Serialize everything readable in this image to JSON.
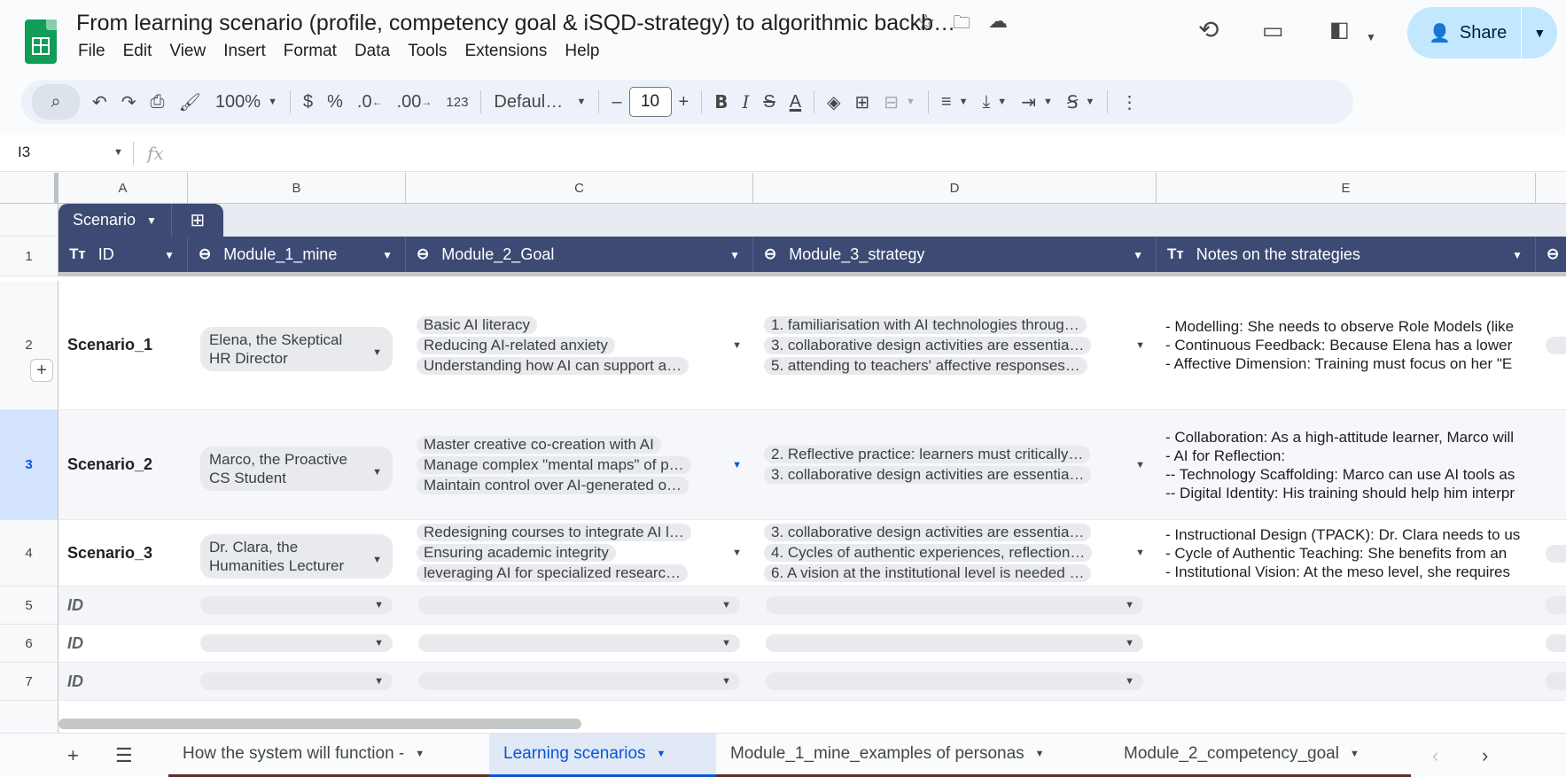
{
  "doc": {
    "title": "From learning scenario (profile, competency goal & iSQD-strategy) to algorithmic backb…",
    "menu": [
      "File",
      "Edit",
      "View",
      "Insert",
      "Format",
      "Data",
      "Tools",
      "Extensions",
      "Help"
    ],
    "share_label": "Share"
  },
  "toolbar": {
    "zoom": "100%",
    "currency": "$",
    "percent": "%",
    "dec_decrease": ".0",
    "dec_increase": ".00",
    "number_format": "123",
    "font": "Defaul…",
    "font_size": "10",
    "minus": "–",
    "plus": "+"
  },
  "formula_bar": {
    "cell_ref": "I3",
    "fx": "fx"
  },
  "columns": [
    "A",
    "B",
    "C",
    "D",
    "E"
  ],
  "table": {
    "name": "Scenario",
    "headers": [
      "ID",
      "Module_1_mine",
      "Module_2_Goal",
      "Module_3_strategy",
      "Notes on the strategies"
    ]
  },
  "rows": [
    {
      "num": "2",
      "id": "Scenario_1",
      "persona": "Elena, the Skeptical HR Director",
      "goals": [
        "Basic AI literacy",
        "Reducing AI-related anxiety",
        "Understanding how AI can support a…"
      ],
      "strategies": [
        "1. familiarisation with AI technologies throug…",
        "3. collaborative design activities are essentia…",
        "5. attending to teachers' affective responses…"
      ],
      "notes": [
        "- Modelling: She needs to observe Role Models (like",
        "- Continuous Feedback: Because Elena has a lower",
        "- Affective Dimension: Training must focus on her \"E"
      ]
    },
    {
      "num": "3",
      "id": "Scenario_2",
      "persona": "Marco, the Proactive CS Student",
      "goals": [
        "Master creative co-creation with AI",
        "Manage complex \"mental maps\" of p…",
        "Maintain control over AI-generated o…"
      ],
      "strategies": [
        "2. Reflective practice: learners must critically…",
        "3. collaborative design activities are essentia…"
      ],
      "notes": [
        "- Collaboration: As a high-attitude learner, Marco will",
        "- AI for Reflection:",
        "-- Technology Scaffolding: Marco can use AI tools as",
        "-- Digital Identity: His training should help him interpr"
      ]
    },
    {
      "num": "4",
      "id": "Scenario_3",
      "persona": "Dr. Clara, the Humanities Lecturer",
      "goals": [
        "Redesigning courses to integrate AI l…",
        "Ensuring academic integrity",
        "leveraging AI for specialized researc…"
      ],
      "strategies": [
        "3. collaborative design activities are essentia…",
        "4. Cycles of authentic experiences, reflection…",
        "6. A vision at the institutional level is needed …"
      ],
      "notes": [
        "- Instructional Design (TPACK): Dr. Clara needs to us",
        "- Cycle of Authentic Teaching: She benefits from an",
        "- Institutional Vision: At the meso level, she requires"
      ]
    }
  ],
  "empty_rows": [
    {
      "num": "5",
      "id": "ID"
    },
    {
      "num": "6",
      "id": "ID"
    },
    {
      "num": "7",
      "id": "ID"
    }
  ],
  "sheets": [
    {
      "label": "How the system will function -",
      "active": false
    },
    {
      "label": "Learning scenarios",
      "active": true
    },
    {
      "label": "Module_1_mine_examples of personas",
      "active": false
    },
    {
      "label": "Module_2_competency_goal",
      "active": false
    }
  ],
  "colors": {
    "table_header": "#3d4a74",
    "active_tab": "#0b57d0",
    "share_bg": "#c2e7ff",
    "logo_green": "#0f9d58"
  }
}
